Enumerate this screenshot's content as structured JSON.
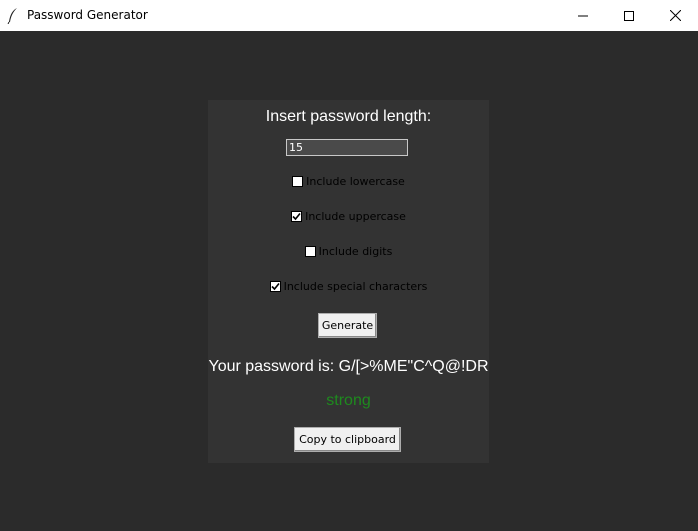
{
  "window": {
    "title": "Password Generator"
  },
  "form": {
    "prompt": "Insert password length:",
    "length_value": "15",
    "options": [
      {
        "label": "Include lowercase",
        "checked": false
      },
      {
        "label": "Include uppercase",
        "checked": true
      },
      {
        "label": "Include digits",
        "checked": false
      },
      {
        "label": "Include special characters",
        "checked": true
      }
    ],
    "generate_label": "Generate",
    "result_text": "Your password is: G/[>%ME\"C^Q@!DR",
    "strength_text": "strong",
    "copy_label": "Copy to clipboard"
  },
  "colors": {
    "strength": "#1e8a1e",
    "panel": "#333333",
    "background": "#2b2b2b"
  },
  "icons": {
    "app": "feather-icon",
    "minimize": "minimize-icon",
    "maximize": "maximize-icon",
    "close": "close-icon"
  }
}
